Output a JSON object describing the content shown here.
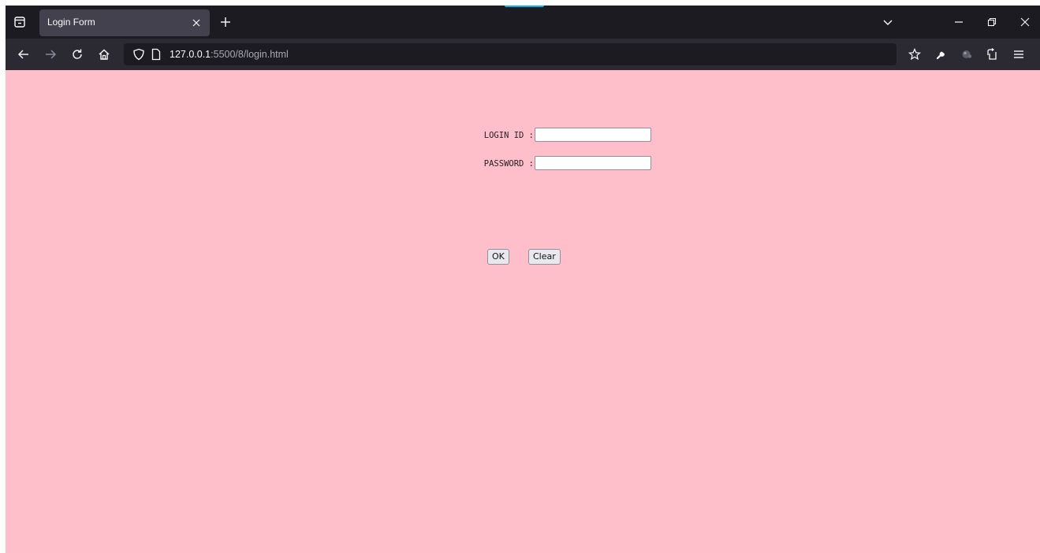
{
  "browser": {
    "tab": {
      "title": "Login Form"
    },
    "url": {
      "host": "127.0.0.1",
      "path": ":5500/8/login.html"
    }
  },
  "form": {
    "login_id_label": "LOGIN ID :",
    "login_id_value": "",
    "password_label": "PASSWORD :",
    "password_value": "",
    "ok_label": "OK",
    "clear_label": "Clear"
  },
  "colors": {
    "page_background": "#ffbfca",
    "browser_chrome": "#1c1b22",
    "toolbar": "#2b2a33"
  }
}
